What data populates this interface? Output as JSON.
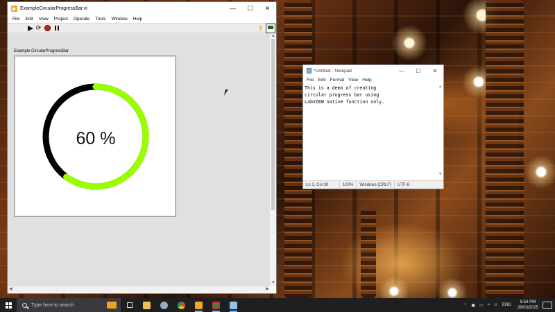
{
  "labview": {
    "title": "ExampleCircularProgressBar.vi",
    "menu": [
      "File",
      "Edit",
      "View",
      "Project",
      "Operate",
      "Tools",
      "Window",
      "Help"
    ],
    "control_label": "Example CircularProgressBar",
    "progress_text": "60 %",
    "progress_fraction": 0.6,
    "colors": {
      "progress": "#99ff00",
      "track": "#000000"
    }
  },
  "notepad": {
    "title": "*Untitled - Notepad",
    "menu": [
      "File",
      "Edit",
      "Format",
      "View",
      "Help"
    ],
    "text": "This is a demo of creating\ncircular progress bar using\nLabVIEW native function only.",
    "status": {
      "position": "Ln 3, Col 30",
      "zoom": "100%",
      "line_ending": "Windows (CRLF)",
      "encoding": "UTF-8"
    }
  },
  "taskbar": {
    "search_placeholder": "Type here to search",
    "language": "ENG",
    "time": "8:54 PM",
    "date": "26/03/2025",
    "apps": [
      "task-view",
      "file-explorer",
      "connect",
      "chrome",
      "labview",
      "labview-project",
      "notepad"
    ]
  }
}
